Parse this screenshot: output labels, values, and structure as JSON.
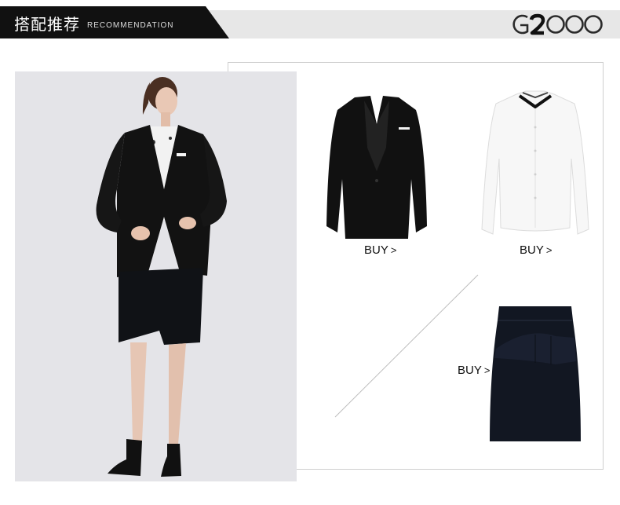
{
  "header": {
    "title_cn": "搭配推荐",
    "title_en": "RECOMMENDATION",
    "logo_text": "G2000"
  },
  "products": [
    {
      "name": "jacket",
      "buy_label": "BUY",
      "chevron": ">"
    },
    {
      "name": "shirt",
      "buy_label": "BUY",
      "chevron": ">"
    },
    {
      "name": "skirt",
      "buy_label": "BUY",
      "chevron": ">"
    }
  ],
  "colors": {
    "header_black": "#111111",
    "header_gray": "#e7e7e7",
    "photo_bg": "#e4e4e8",
    "frame_line": "#cfcfcf"
  }
}
